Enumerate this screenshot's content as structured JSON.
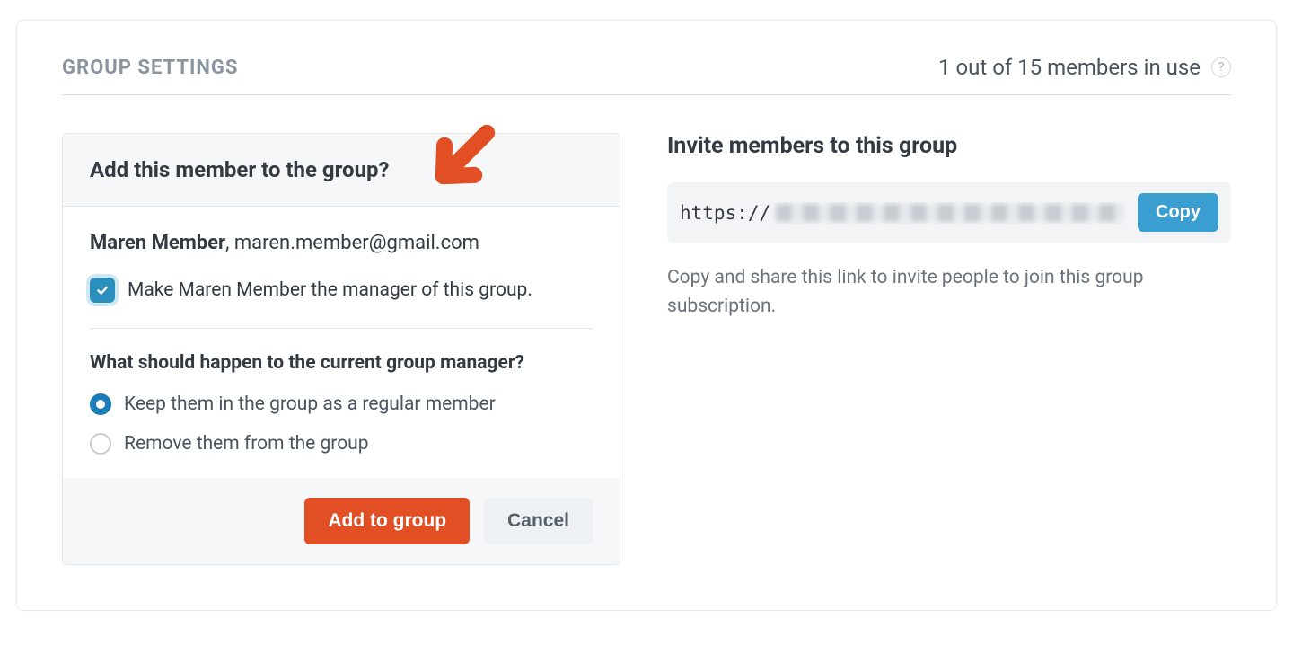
{
  "header": {
    "section_title": "GROUP SETTINGS",
    "members_status": "1 out of 15 members in use",
    "help_symbol": "?"
  },
  "card": {
    "title": "Add this member to the group?",
    "member_name": "Maren Member",
    "member_sep": ", ",
    "member_email": "maren.member@gmail.com",
    "make_manager_label": "Make Maren Member the manager of this group.",
    "make_manager_checked": true,
    "question": "What should happen to the current group manager?",
    "options": [
      {
        "label": "Keep them in the group as a regular member",
        "selected": true
      },
      {
        "label": "Remove them from the group",
        "selected": false
      }
    ],
    "primary_button": "Add to group",
    "secondary_button": "Cancel"
  },
  "invite": {
    "title": "Invite members to this group",
    "link_prefix": "https://",
    "copy_button": "Copy",
    "description": "Copy and share this link to invite people to join this group subscription."
  },
  "colors": {
    "accent_orange": "#e24f24",
    "accent_blue": "#3a9ed0",
    "checkbox_blue": "#2a8fbd"
  }
}
